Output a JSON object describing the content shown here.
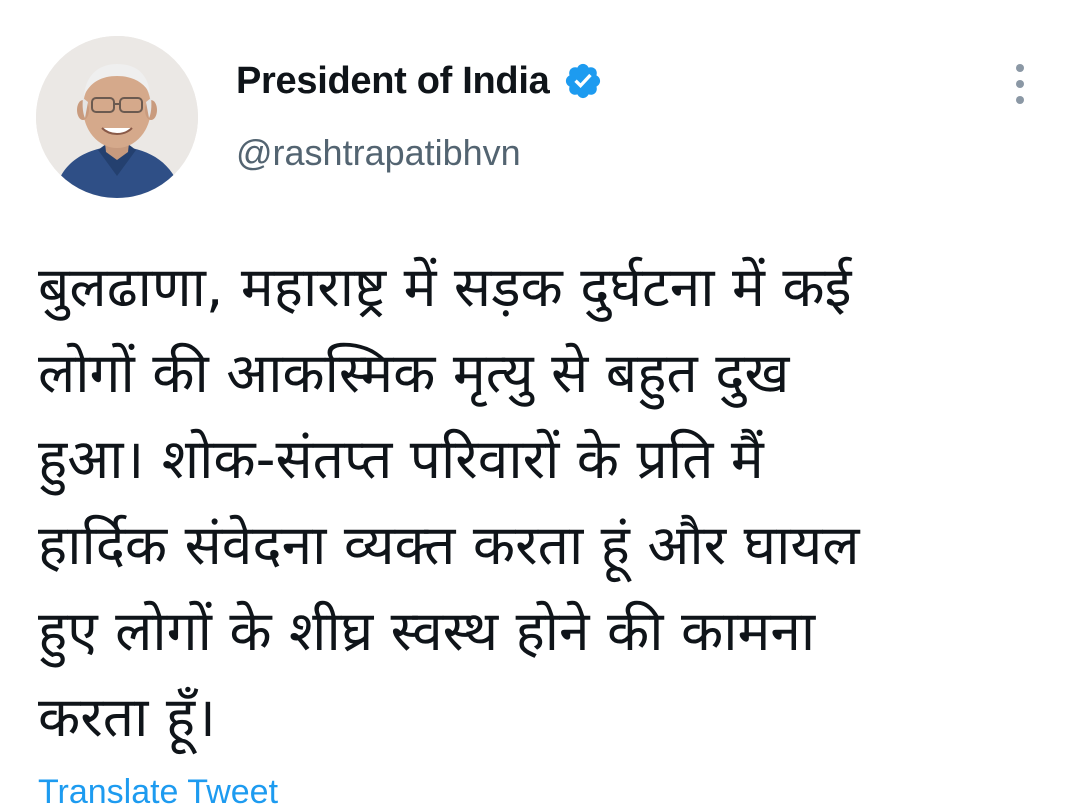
{
  "author": {
    "display_name": "President of India",
    "handle": "@rashtrapatibhvn",
    "verified": true,
    "avatar_icon": "profile-photo",
    "verified_icon": "verified-badge-icon",
    "verified_color": "#1d9bf0"
  },
  "tweet": {
    "lines": [
      "बुलढाणा, महाराष्ट्र में सड़क दुर्घटना में कई",
      "लोगों की आकस्मिक मृत्यु से बहुत दुख",
      "हुआ। शोक-संतप्त परिवारों के प्रति मैं",
      "हार्दिक संवेदना व्यक्त करता हूं और घायल",
      "हुए लोगों के शीघ्र स्वस्थ होने की कामना",
      "करता हूँ।"
    ]
  },
  "actions": {
    "more_icon": "more-vertical-icon",
    "translate_label": "Translate Tweet"
  },
  "colors": {
    "text": "#0f1419",
    "secondary": "#536471",
    "accent": "#1d9bf0"
  }
}
